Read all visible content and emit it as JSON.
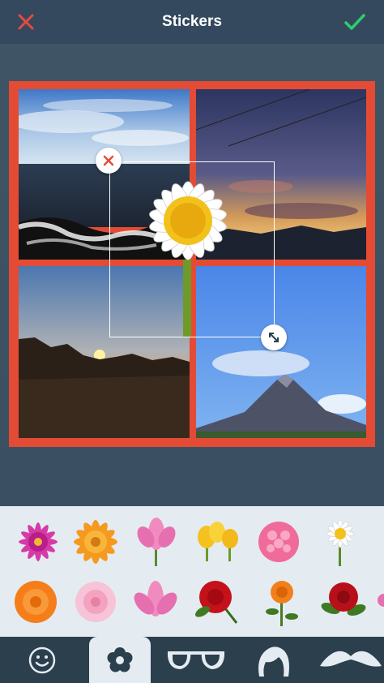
{
  "header": {
    "title": "Stickers",
    "close_icon": "close-x-icon",
    "confirm_icon": "checkmark-icon",
    "accent_close": "#e84a3c",
    "accent_confirm": "#2ecc71"
  },
  "collage": {
    "frame_color": "#e34b35",
    "tiles": [
      "ocean-shore-photo",
      "sunset-sky-photo",
      "sunrise-rocks-photo",
      "volcano-mountain-photo"
    ],
    "sticker": "daisy-flower-sticker"
  },
  "palette": {
    "stickers_row1": [
      "pink-chrysanthemum",
      "orange-dahlia",
      "pink-lotus",
      "yellow-tulips",
      "pink-rose-ball",
      "white-daisy"
    ],
    "stickers_row2": [
      "orange-rose",
      "pink-rose",
      "pink-lotus-2",
      "red-rose",
      "orange-rose-sprig",
      "red-rose-leaves",
      "pink-flower-partial"
    ]
  },
  "tabs": [
    {
      "name": "emoji-tab",
      "icon": "smiley-icon"
    },
    {
      "name": "flowers-tab",
      "icon": "flower-icon"
    },
    {
      "name": "glasses-tab",
      "icon": "glasses-icon"
    },
    {
      "name": "hair-tab",
      "icon": "hair-icon"
    },
    {
      "name": "mustache-tab",
      "icon": "mustache-icon"
    }
  ]
}
